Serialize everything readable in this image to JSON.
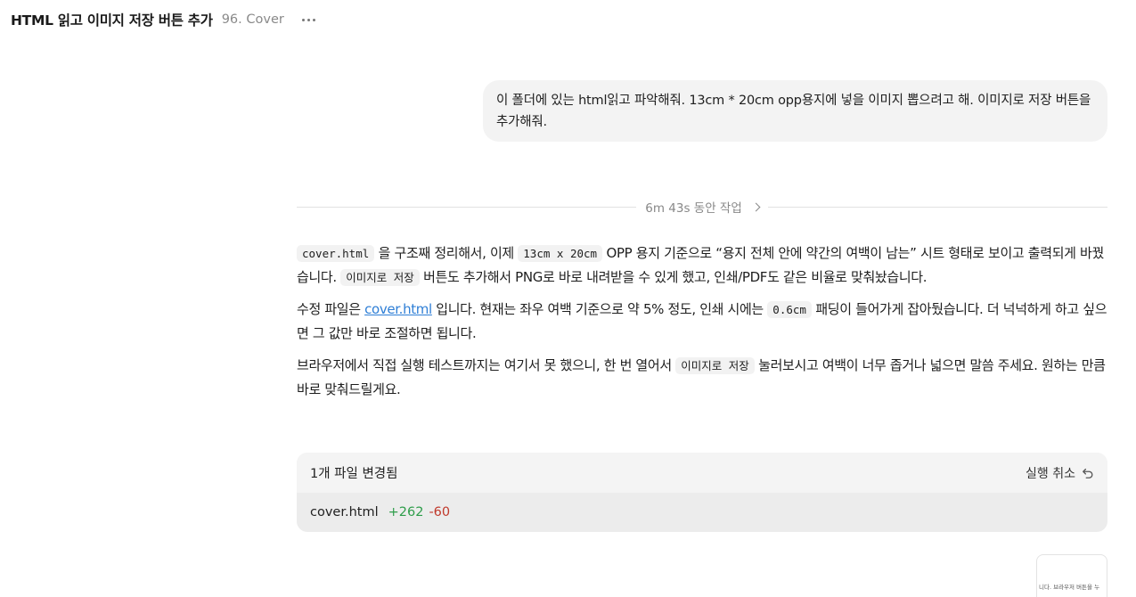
{
  "header": {
    "title": "HTML 읽고 이미지 저장 버튼 추가",
    "subtitle": "96. Cover",
    "more_icon": "more-horizontal-icon"
  },
  "user_message": "이 폴더에 있는 html읽고 파악해줘. 13cm * 20cm opp용지에 넣을 이미지 뽑으려고 해. 이미지로 저장 버튼을 추가해줘.",
  "work_summary": {
    "label": "6m 43s 동안 작업",
    "icon": "chevron-right-icon"
  },
  "assistant": {
    "p1": {
      "code1": "cover.html",
      "t1": " 을 구조째 정리해서, 이제 ",
      "code2": "13cm x 20cm",
      "t2": " OPP 용지 기준으로 “용지 전체 안에 약간의 여백이 남는” 시트 형태로 보이고 출력되게 바꿨습니다. ",
      "code3": "이미지로 저장",
      "t3": " 버튼도 추가해서 PNG로 바로 내려받을 수 있게 했고, 인쇄/PDF도 같은 비율로 맞춰놨습니다."
    },
    "p2": {
      "t1": "수정 파일은 ",
      "link": "cover.html",
      "t2": " 입니다. 현재는 좌우 여백 기준으로 약 5% 정도, 인쇄 시에는 ",
      "code1": "0.6cm",
      "t3": " 패딩이 들어가게 잡아뒀습니다. 더 넉넉하게 하고 싶으면 그 값만 바로 조절하면 됩니다."
    },
    "p3": {
      "t1": "브라우저에서 직접 실행 테스트까지는 여기서 못 했으니, 한 번 열어서 ",
      "code1": "이미지로 저장",
      "t2": " 눌러보시고 여백이 너무 좁거나 넓으면 말씀 주세요. 원하는 만큼 바로 맞춰드릴게요."
    }
  },
  "changes": {
    "title": "1개 파일 변경됨",
    "undo_label": "실행 취소",
    "undo_icon": "undo-icon",
    "file": {
      "name": "cover.html",
      "added": "+262",
      "removed": "-60"
    },
    "colors": {
      "added": "#2e9d4a",
      "removed": "#c0392b"
    }
  },
  "thumbnail": {
    "text": "니다. 브라우저 버튼을 누"
  }
}
